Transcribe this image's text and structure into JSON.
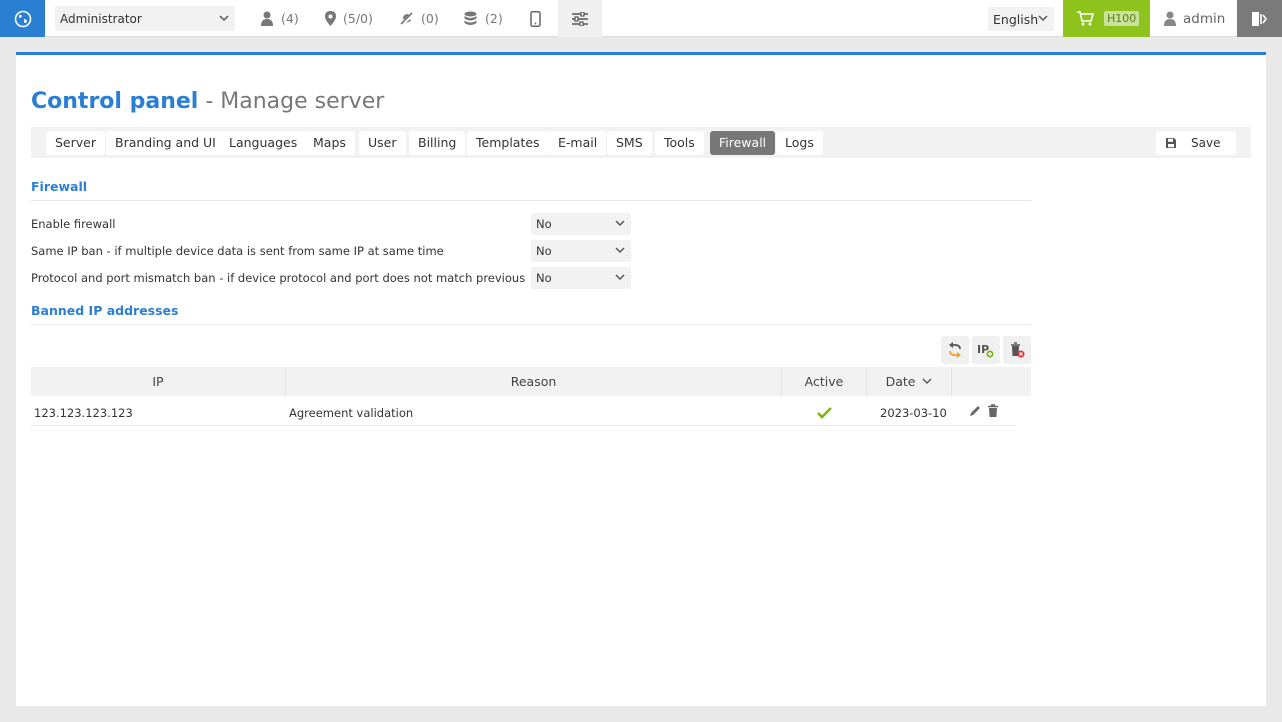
{
  "topbar": {
    "globe_icon": "globe-icon",
    "role": "Administrator",
    "users_count": "(4)",
    "objects_count": "(5/0)",
    "offline_count": "(0)",
    "stack_count": "(2)",
    "language": "English",
    "cart_badge": "H100",
    "username": "admin"
  },
  "page": {
    "title": "Control panel",
    "subtitle": "- Manage server"
  },
  "tabs": [
    "Server",
    "Branding and UI",
    "Languages",
    "Maps",
    "User",
    "Billing",
    "Templates",
    "E-mail",
    "SMS",
    "Tools",
    "Firewall",
    "Logs"
  ],
  "active_tab": "Firewall",
  "save_label": "Save",
  "firewall": {
    "section_title": "Firewall",
    "fields": [
      {
        "label": "Enable firewall",
        "value": "No"
      },
      {
        "label": "Same IP ban - if multiple device data is sent from same IP at same time",
        "value": "No"
      },
      {
        "label": "Protocol and port mismatch ban - if device protocol and port does not match previous",
        "value": "No"
      }
    ]
  },
  "banned": {
    "section_title": "Banned IP addresses",
    "columns": [
      "IP",
      "Reason",
      "Active",
      "Date"
    ],
    "rows": [
      {
        "ip": "123.123.123.123",
        "reason": "Agreement validation",
        "active": true,
        "date": "2023-03-10"
      }
    ]
  },
  "colors": {
    "accent": "#2b7fd2",
    "cart": "#8ec31e",
    "active_check": "#7cb518"
  }
}
